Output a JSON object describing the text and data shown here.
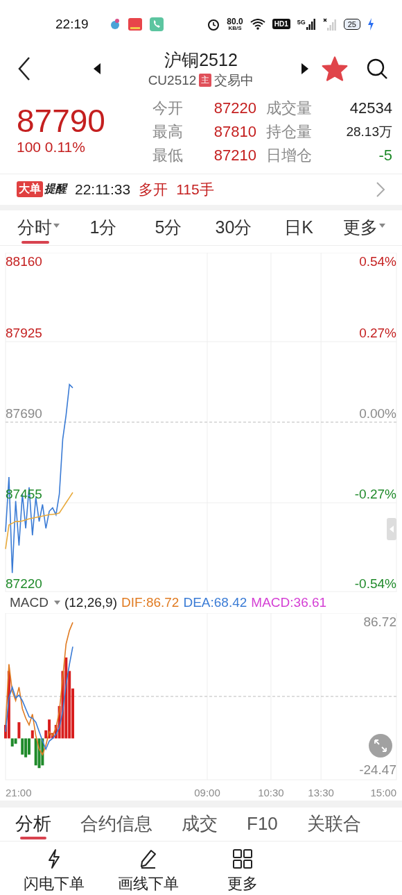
{
  "status_bar": {
    "time": "22:19",
    "speed": "80.0",
    "speed_unit": "KB/S",
    "hd": "HD1",
    "network": "5G",
    "battery": "25",
    "charging": true
  },
  "header": {
    "title": "沪铜2512",
    "code": "CU2512",
    "badge": "主",
    "status": "交易中",
    "favorited": true
  },
  "quote": {
    "price": "87790",
    "change": "100 0.11%",
    "stats": [
      {
        "label": "今开",
        "value": "87220",
        "color": "#c41f1f"
      },
      {
        "label": "成交量",
        "value": "42534",
        "color": "#222222"
      },
      {
        "label": "最高",
        "value": "87810",
        "color": "#c41f1f"
      },
      {
        "label": "持仓量",
        "value": "28.13万",
        "color": "#222222"
      },
      {
        "label": "最低",
        "value": "87210",
        "color": "#c41f1f"
      },
      {
        "label": "日增仓",
        "value": "-5",
        "color": "#1f8a2a"
      }
    ]
  },
  "alert": {
    "badge": "大单",
    "badge_label": "提醒",
    "time": "22:11:33",
    "action": "多开",
    "amount": "115手"
  },
  "period_tabs": [
    {
      "label": "分时",
      "selected": true,
      "has_menu": true
    },
    {
      "label": "1分",
      "selected": false,
      "has_menu": false
    },
    {
      "label": "5分",
      "selected": false,
      "has_menu": false
    },
    {
      "label": "30分",
      "selected": false,
      "has_menu": false
    },
    {
      "label": "日K",
      "selected": false,
      "has_menu": false
    },
    {
      "label": "更多",
      "selected": false,
      "has_menu": true
    }
  ],
  "price_chart": {
    "levels": [
      {
        "price": "88160",
        "percent": "0.54%",
        "color": "#c41f1f"
      },
      {
        "price": "87925",
        "percent": "0.27%",
        "color": "#c41f1f"
      },
      {
        "price": "87690",
        "percent": "0.00%",
        "color": "#8a8a8a"
      },
      {
        "price": "87455",
        "percent": "-0.27%",
        "color": "#1f8a2a"
      },
      {
        "price": "87220",
        "percent": "-0.54%",
        "color": "#1f8a2a"
      }
    ]
  },
  "macd": {
    "indicator": "MACD",
    "params": "(12,26,9)",
    "legend": [
      {
        "text": "DIF:86.72",
        "color": "#e07b22"
      },
      {
        "text": "DEA:68.42",
        "color": "#3a7bd5"
      },
      {
        "text": "MACD:36.61",
        "color": "#d43fd4"
      }
    ],
    "axis_labels": [
      "86.72",
      "-24.47"
    ],
    "time_labels": [
      "21:00",
      "09:00",
      "10:30",
      "13:30",
      "15:00"
    ]
  },
  "bottom_tabs": [
    {
      "label": "分析",
      "selected": true
    },
    {
      "label": "合约信息",
      "selected": false
    },
    {
      "label": "成交",
      "selected": false
    },
    {
      "label": "F10",
      "selected": false
    },
    {
      "label": "关联合",
      "selected": false
    }
  ],
  "actions": [
    {
      "label": "闪电下单",
      "kind": "bolt"
    },
    {
      "label": "画线下单",
      "kind": "pencil"
    },
    {
      "label": "更多",
      "kind": "grid"
    }
  ]
}
